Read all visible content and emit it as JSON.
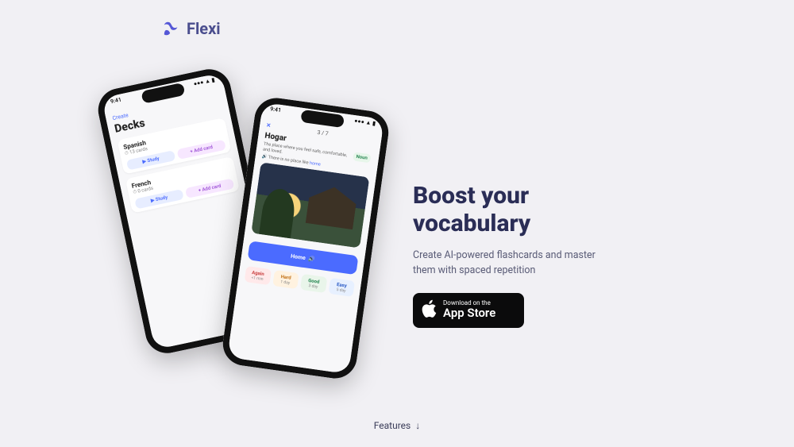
{
  "brand": {
    "name": "Flexi"
  },
  "hero": {
    "title": "Boost your vocabulary",
    "subtitle": "Create AI-powered flashcards and master them with spaced repetition",
    "appstore_top": "Download on the",
    "appstore_bottom": "App Store"
  },
  "phone_a": {
    "time": "9:41",
    "create": "Create",
    "title": "Decks",
    "decks": [
      {
        "name": "Spanish",
        "sub": "13 cards",
        "study": "Study",
        "add": "+ Add card"
      },
      {
        "name": "French",
        "sub": "0 cards",
        "study": "Study",
        "add": "+ Add card"
      }
    ]
  },
  "phone_b": {
    "time": "9:41",
    "close": "✕",
    "counter": "3 / 7",
    "word": "Hogar",
    "noun_chip": "Noun",
    "definition": "The place where you feel safe, comfortable, and loved.",
    "example_prefix": "There is no place like ",
    "example_hl": "home",
    "bluebar": "Home",
    "ratings": [
      {
        "k": "again",
        "label": "Again",
        "hint": "<1 min"
      },
      {
        "k": "hard",
        "label": "Hard",
        "hint": "1 day"
      },
      {
        "k": "good",
        "label": "Good",
        "hint": "3 day"
      },
      {
        "k": "easy",
        "label": "Easy",
        "hint": "5 day"
      }
    ]
  },
  "footer": {
    "features": "Features"
  }
}
